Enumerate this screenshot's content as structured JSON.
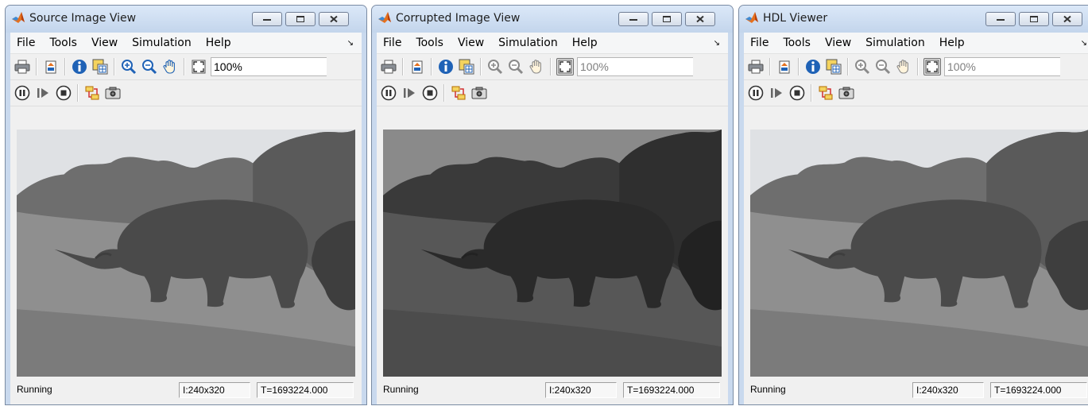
{
  "windows": [
    {
      "title": "Source Image View",
      "zoom": "100%",
      "zoom_tools_enabled": true,
      "fit_active": false,
      "image_tone": "source",
      "status": "Running",
      "size": "I:240x320",
      "time": "T=1693224.000"
    },
    {
      "title": "Corrupted Image View",
      "zoom": "100%",
      "zoom_tools_enabled": false,
      "fit_active": true,
      "image_tone": "dark",
      "status": "Running",
      "size": "I:240x320",
      "time": "T=1693224.000"
    },
    {
      "title": "HDL Viewer",
      "zoom": "100%",
      "zoom_tools_enabled": false,
      "fit_active": true,
      "image_tone": "source",
      "status": "Running",
      "size": "I:240x320",
      "time": "T=1693224.000"
    }
  ],
  "menu": [
    "File",
    "Tools",
    "View",
    "Simulation",
    "Help"
  ],
  "toolbar_icons": [
    "print-icon",
    "print-to-figure-icon",
    "info-icon",
    "pixel-region-icon",
    "zoom-in-icon",
    "zoom-out-icon",
    "pan-icon",
    "fit-to-view-icon"
  ],
  "sim_icons": [
    "pause-icon",
    "step-forward-icon",
    "stop-icon",
    "highlight-block-icon",
    "snapshot-icon"
  ],
  "dock_glyph": "↘",
  "colors": {
    "frame": "#c9d9ee",
    "accent_icon": "#1f62b6",
    "matlab_orange": "#e5701d"
  }
}
